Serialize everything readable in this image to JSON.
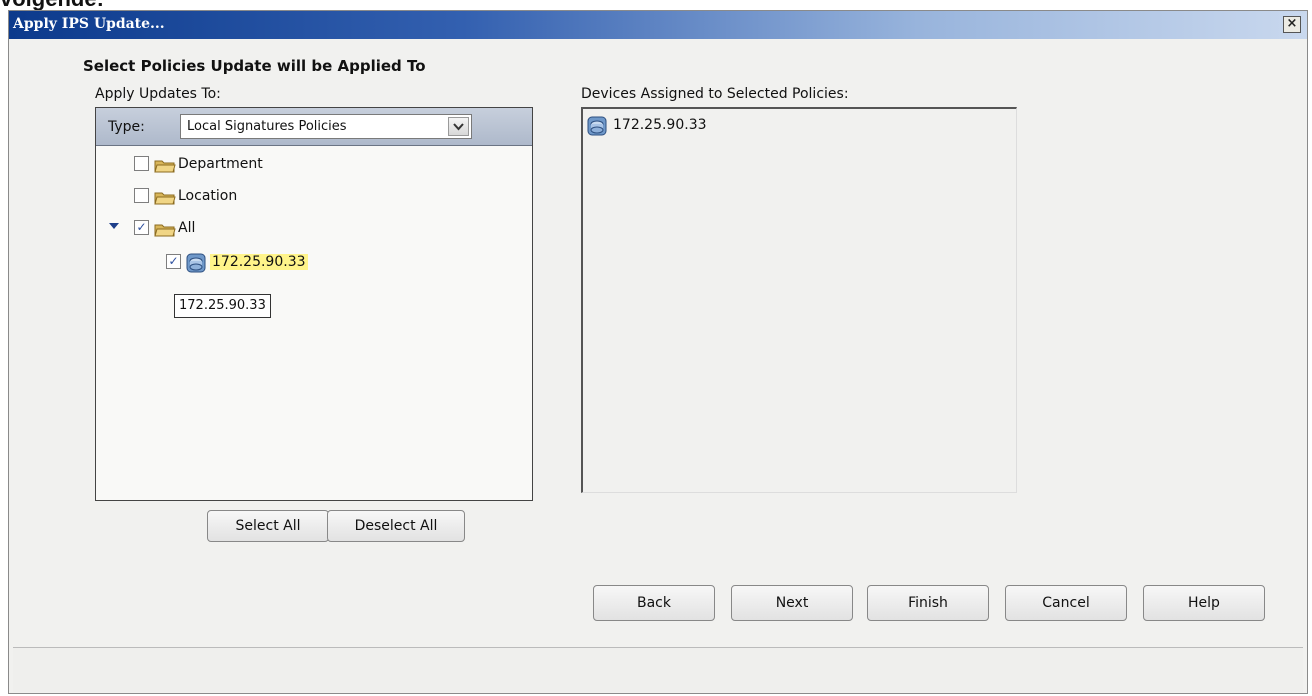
{
  "page_heading": "volgende:",
  "dialog": {
    "title": "Apply IPS Update...",
    "close_glyph": "×"
  },
  "section_heading": "Select Policies Update will be Applied To",
  "apply_updates": {
    "label": "Apply Updates To:",
    "type_label": "Type:",
    "type_value": "Local Signatures Policies"
  },
  "tree": {
    "items": [
      {
        "label": "Department",
        "checked": false,
        "icon": "folder-icon"
      },
      {
        "label": "Location",
        "checked": false,
        "icon": "folder-icon"
      },
      {
        "label": "All",
        "checked": true,
        "icon": "folder-icon",
        "expanded": true
      },
      {
        "label": "172.25.90.33",
        "checked": true,
        "icon": "device-icon",
        "highlighted": true
      }
    ],
    "tooltip": "172.25.90.33"
  },
  "tree_buttons": {
    "select_all": "Select All",
    "deselect_all": "Deselect All"
  },
  "devices": {
    "label": "Devices Assigned to Selected Policies:",
    "items": [
      {
        "label": "172.25.90.33",
        "icon": "device-icon"
      }
    ]
  },
  "wizard_buttons": {
    "back": "Back",
    "next": "Next",
    "finish": "Finish",
    "cancel": "Cancel",
    "help": "Help"
  },
  "colors": {
    "titlebar_start": "#0c3a8c",
    "highlight": "#fff48a"
  }
}
